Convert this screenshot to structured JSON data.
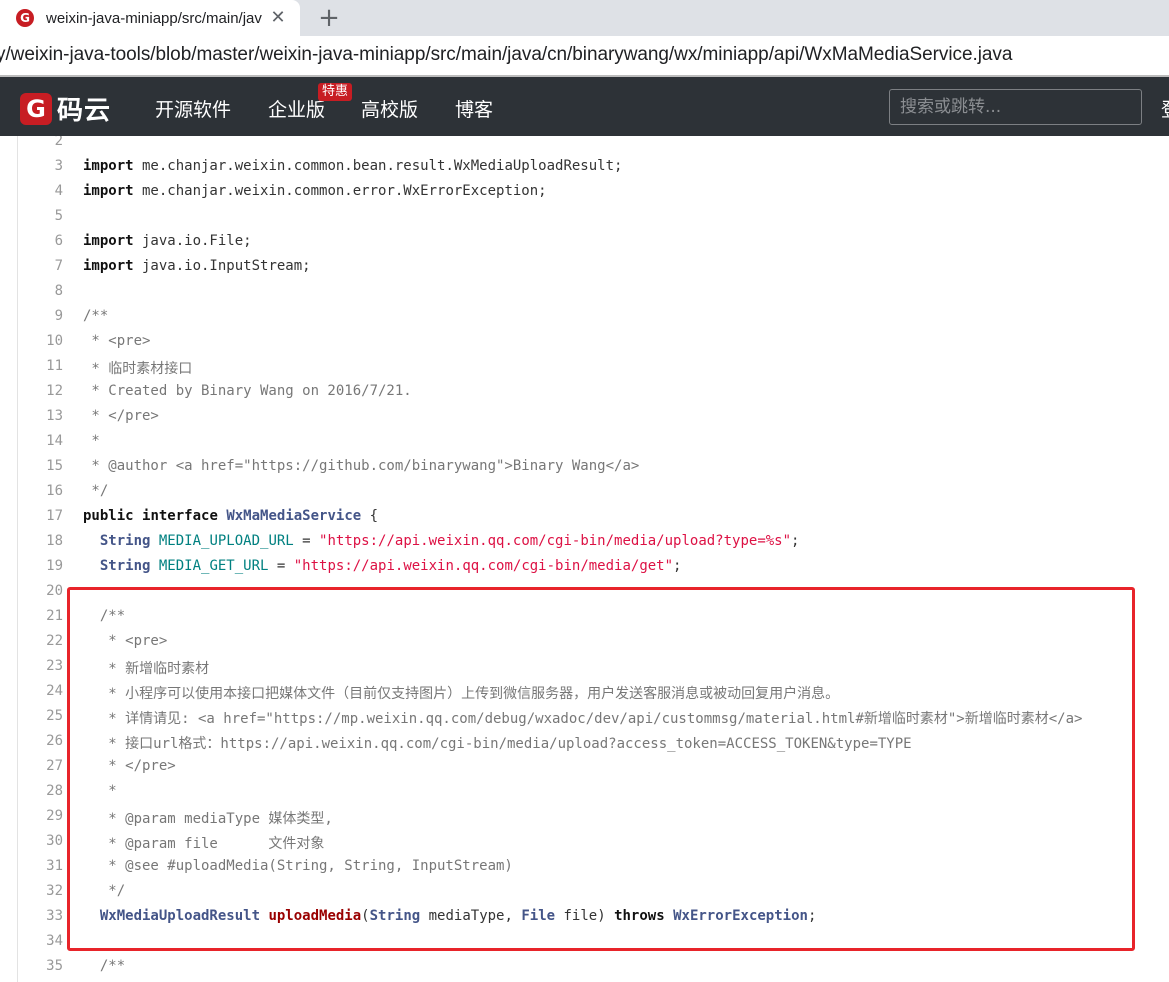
{
  "browser": {
    "tab_title": "weixin-java-miniapp/src/main/java/cn/binarywang/wx/miniapp/api/WxMaMediaService.java",
    "tab_close": "✕",
    "new_tab": "+",
    "url": "y/weixin-java-tools/blob/master/weixin-java-miniapp/src/main/java/cn/binarywang/wx/miniapp/api/WxMaMediaService.java"
  },
  "header": {
    "logo_mark": "G",
    "logo_text": "码云",
    "nav": [
      "开源软件",
      "企业版",
      "高校版",
      "博客"
    ],
    "badge": "特惠",
    "search_placeholder": "搜索或跳转...",
    "edge_text": "登"
  },
  "code_lines": [
    {
      "n": "2",
      "t": ""
    },
    {
      "n": "3",
      "t": "import me.chanjar.weixin.common.bean.result.WxMediaUploadResult;"
    },
    {
      "n": "4",
      "t": "import me.chanjar.weixin.common.error.WxErrorException;"
    },
    {
      "n": "5",
      "t": ""
    },
    {
      "n": "6",
      "t": "import java.io.File;"
    },
    {
      "n": "7",
      "t": "import java.io.InputStream;"
    },
    {
      "n": "8",
      "t": ""
    },
    {
      "n": "9",
      "t": "/**"
    },
    {
      "n": "10",
      "t": " * <pre>"
    },
    {
      "n": "11",
      "t": " * 临时素材接口"
    },
    {
      "n": "12",
      "t": " * Created by Binary Wang on 2016/7/21."
    },
    {
      "n": "13",
      "t": " * </pre>"
    },
    {
      "n": "14",
      "t": " *"
    },
    {
      "n": "15",
      "t": " * @author <a href=\"https://github.com/binarywang\">Binary Wang</a>"
    },
    {
      "n": "16",
      "t": " */"
    },
    {
      "n": "17",
      "t": "public interface WxMaMediaService {"
    },
    {
      "n": "18",
      "t": "  String MEDIA_UPLOAD_URL = \"https://api.weixin.qq.com/cgi-bin/media/upload?type=%s\";"
    },
    {
      "n": "19",
      "t": "  String MEDIA_GET_URL = \"https://api.weixin.qq.com/cgi-bin/media/get\";"
    },
    {
      "n": "20",
      "t": ""
    },
    {
      "n": "21",
      "t": "  /**"
    },
    {
      "n": "22",
      "t": "   * <pre>"
    },
    {
      "n": "23",
      "t": "   * 新增临时素材"
    },
    {
      "n": "24",
      "t": "   * 小程序可以使用本接口把媒体文件（目前仅支持图片）上传到微信服务器，用户发送客服消息或被动回复用户消息。"
    },
    {
      "n": "25",
      "t": "   * 详情请见: <a href=\"https://mp.weixin.qq.com/debug/wxadoc/dev/api/custommsg/material.html#新增临时素材\">新增临时素材</a>"
    },
    {
      "n": "26",
      "t": "   * 接口url格式：https://api.weixin.qq.com/cgi-bin/media/upload?access_token=ACCESS_TOKEN&type=TYPE"
    },
    {
      "n": "27",
      "t": "   * </pre>"
    },
    {
      "n": "28",
      "t": "   *"
    },
    {
      "n": "29",
      "t": "   * @param mediaType 媒体类型,"
    },
    {
      "n": "30",
      "t": "   * @param file      文件对象"
    },
    {
      "n": "31",
      "t": "   * @see #uploadMedia(String, String, InputStream)"
    },
    {
      "n": "32",
      "t": "   */"
    },
    {
      "n": "33",
      "t": "  WxMediaUploadResult uploadMedia(String mediaType, File file) throws WxErrorException;"
    },
    {
      "n": "34",
      "t": ""
    },
    {
      "n": "35",
      "t": "  /**"
    }
  ]
}
